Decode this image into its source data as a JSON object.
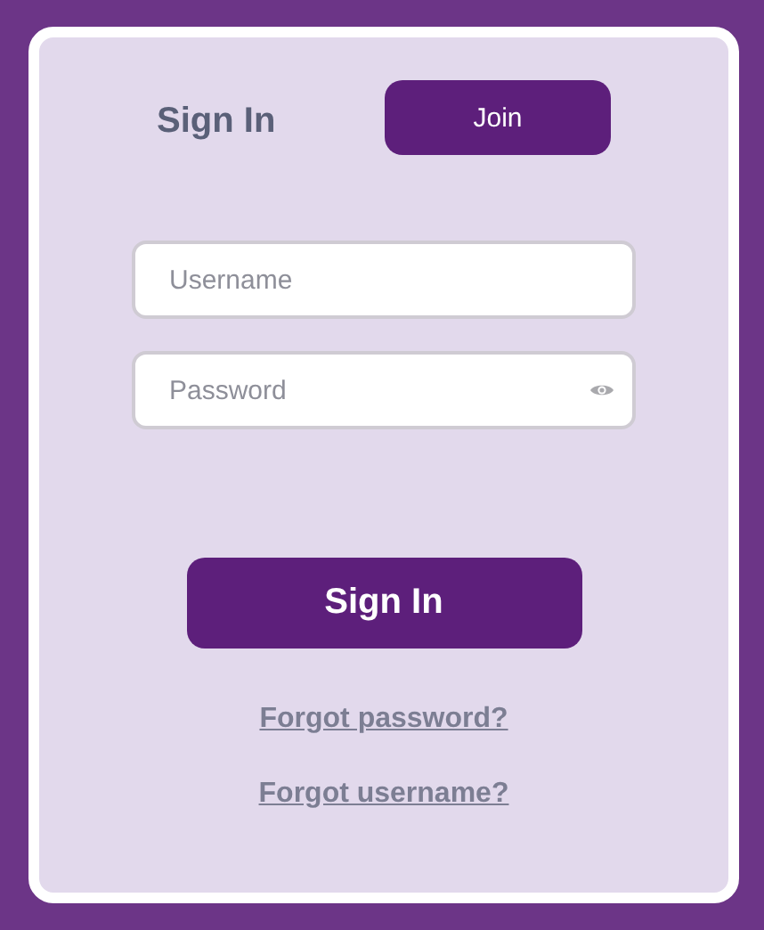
{
  "tabs": [
    {
      "label": "Sign In",
      "selected": true
    },
    {
      "label": "Join",
      "selected": false
    }
  ],
  "fields": [
    {
      "kind": "text",
      "placeholder": "Username"
    },
    {
      "kind": "password",
      "placeholder": "Password"
    }
  ],
  "submit": "Sign In",
  "links": [
    "Forgot password?",
    "Forgot username?"
  ]
}
